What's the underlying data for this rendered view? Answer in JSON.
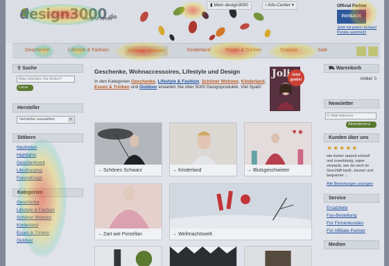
{
  "header": {
    "logo": "design3000",
    "logo_suffix": ".de",
    "tagline": "shop of ideas",
    "util_account": "Mein design3000",
    "util_info": "Info-Center",
    "partner_label": "Official Partner",
    "partner_badge": "PAYBACK",
    "partner_link": "Jetzt mit jedem Einkauf Punkte sammeln!"
  },
  "nav": {
    "items": [
      "Geschenke",
      "Lifestyle & Fashion",
      "Schöner Wohnen",
      "Kinderland",
      "Essen & Trinken",
      "Outdoor",
      "Sale"
    ]
  },
  "search": {
    "title": "Suche",
    "placeholder": "Was möchten Sie finden?",
    "button": "Los"
  },
  "manufacturer": {
    "title": "Hersteller",
    "select": "Hersteller auswählen"
  },
  "browse": {
    "title": "Stöbern",
    "items": [
      "Neuheiten",
      "Highlights",
      "Geschenkwelt",
      "Lifeshopping",
      "FreundDsign"
    ]
  },
  "categories": {
    "title": "Kategorien",
    "items": [
      "Geschenke",
      "Lifestyle & Fashion",
      "Schöner Wohnen",
      "Kinderland",
      "Essen & Trinken",
      "Outdoor"
    ]
  },
  "main": {
    "heading": "Geschenke, Wohnaccessoires, Lifestyle und Design",
    "intro_pre": "In den Kategorien",
    "intro_links": [
      "Geschenke",
      "Lifestyle & Fashion",
      "Schöner Wohnen",
      "Kinderland",
      "Essen & Trinken",
      "Outdoor"
    ],
    "intro_post": "erwarten Sie über 5000 Designprodukte. Viel Spaß!",
    "magazine_title": "Jolie",
    "magazine_badge": "Jetzt gratis!",
    "cards": [
      "Schönes Schwarz",
      "Kinderland",
      "Blutsgeschwister",
      "Zart wie Porzellan",
      "Weihnachtswelt"
    ]
  },
  "cart": {
    "title": "Warenkorb",
    "items_label": "Artikel: 0"
  },
  "newsletter": {
    "title": "Newsletter",
    "placeholder": "E-Mail-Adresse",
    "button": "Abonnieren"
  },
  "reviews": {
    "title": "Kunden über uns",
    "stars": "★★★★★",
    "text": "wie immer rasend schnell und zuverlässig, super verpackt, wer da noch im Geschäft kauft...besser und bequemer ...",
    "link": "Alle Bewertungen anzeigen"
  },
  "service": {
    "title": "Service",
    "items": [
      "Ersatzteile",
      "Fax-Bestellung",
      "Für Firmenkunden",
      "Für Affiliate-Partner"
    ]
  },
  "media": {
    "title": "Medien"
  },
  "colors": {
    "accent": "#c25a1c",
    "link": "#1a4ea1",
    "button_green": "#5e7d2a"
  }
}
